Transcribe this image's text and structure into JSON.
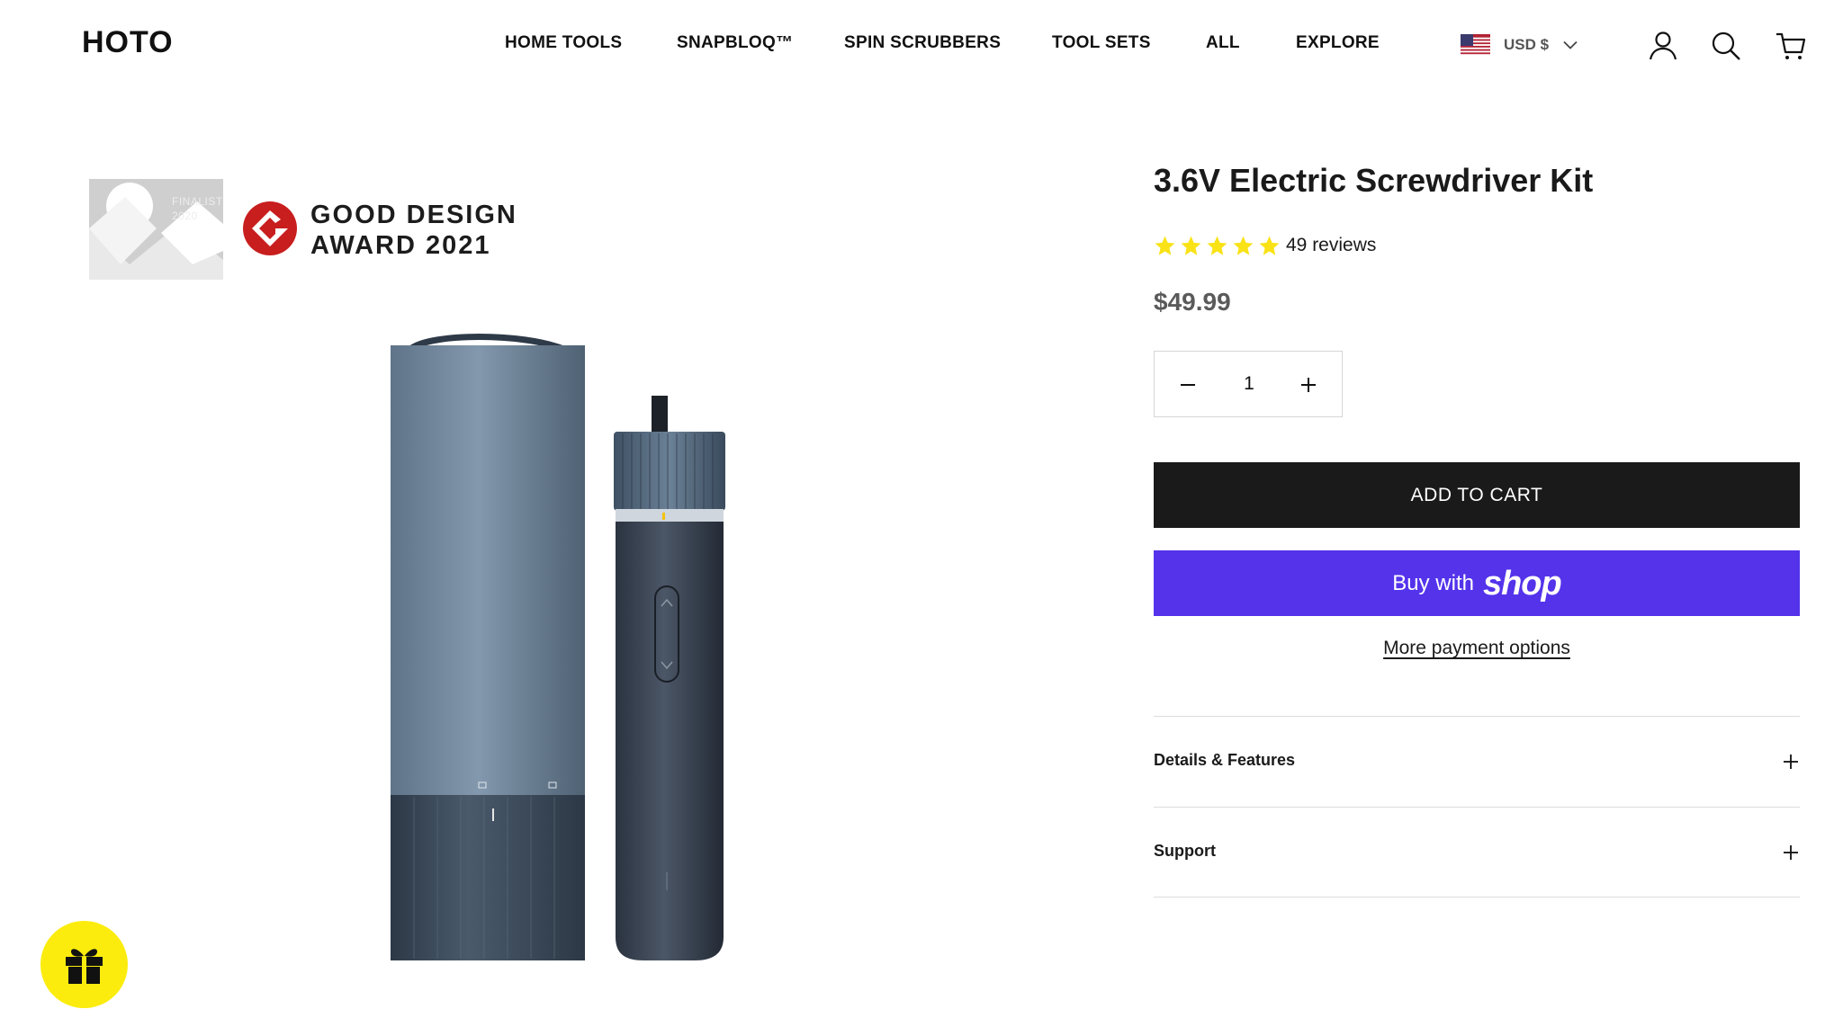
{
  "brand": {
    "logo_text": "HOTO"
  },
  "nav": {
    "items": [
      {
        "label": "HOME TOOLS"
      },
      {
        "label": "SNAPBLOQ™"
      },
      {
        "label": "SPIN SCRUBBERS"
      },
      {
        "label": "TOOL SETS"
      },
      {
        "label": "ALL"
      },
      {
        "label": "EXPLORE"
      }
    ]
  },
  "header": {
    "currency_label": "USD $",
    "icons": [
      "us-flag-icon",
      "chevron-down-icon",
      "account-icon",
      "search-icon",
      "cart-icon"
    ]
  },
  "gallery": {
    "award_if": {
      "line1": "FINALIST",
      "line2": "2020"
    },
    "award_gd": {
      "line1": "GOOD DESIGN",
      "line2": "AWARD 2021"
    }
  },
  "product": {
    "title": "3.6V Electric Screwdriver Kit",
    "rating_stars": 5,
    "reviews_label": "49 reviews",
    "price": "$49.99",
    "quantity": "1",
    "add_to_cart_label": "ADD TO CART",
    "buy_with_label": "Buy with",
    "shop_wordmark": "shop",
    "more_payment_label": "More payment options"
  },
  "accordion": {
    "items": [
      {
        "label": "Details & Features"
      },
      {
        "label": "Support"
      }
    ]
  },
  "colors": {
    "star": "#f9e216",
    "shop_purple": "#5433eb",
    "cart_black": "#1a1a1a",
    "gift_yellow": "#fbec0e"
  }
}
